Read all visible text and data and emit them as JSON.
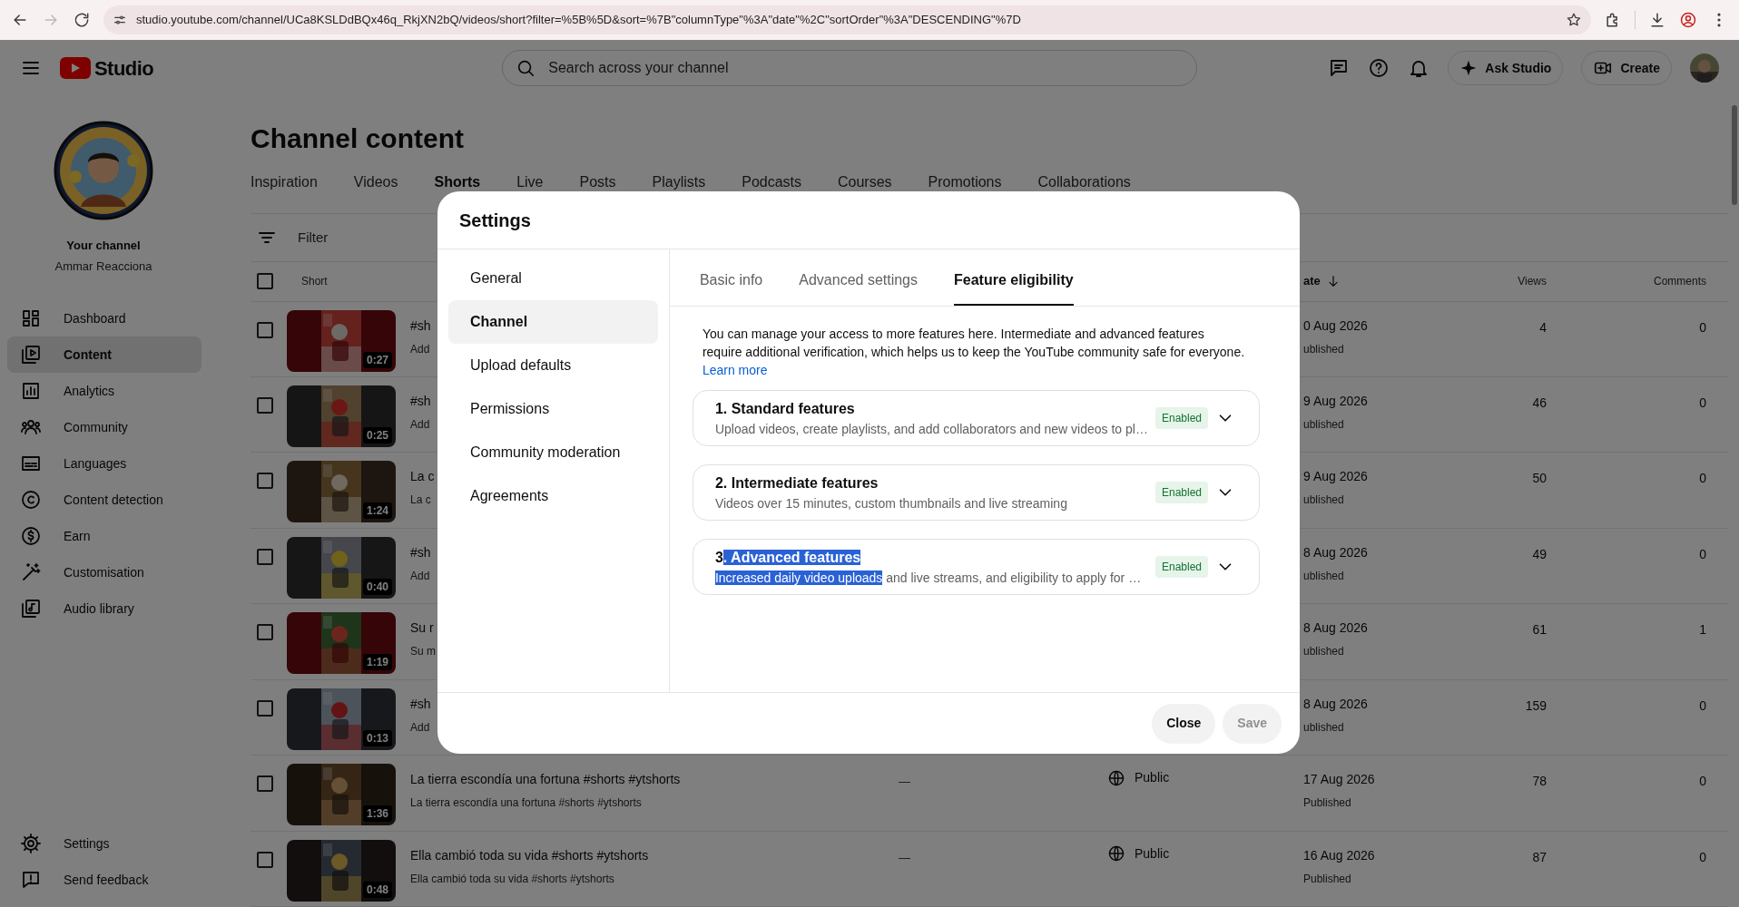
{
  "browser": {
    "url": "studio.youtube.com/channel/UCa8KSLDdBQx46q_RkjXN2bQ/videos/short?filter=%5B%5D&sort=%7B\"columnType\"%3A\"date\"%2C\"sortOrder\"%3A\"DESCENDING\"%7D",
    "back_enabled": true,
    "forward_enabled": false
  },
  "header": {
    "logo_text": "Studio",
    "search_placeholder": "Search across your channel",
    "ask_button": "Ask Studio",
    "create_button": "Create"
  },
  "sidebar": {
    "channel_label": "Your channel",
    "channel_name": "Ammar Reacciona",
    "items": [
      {
        "label": "Dashboard",
        "selected": false
      },
      {
        "label": "Content",
        "selected": true
      },
      {
        "label": "Analytics",
        "selected": false
      },
      {
        "label": "Community",
        "selected": false
      },
      {
        "label": "Languages",
        "selected": false
      },
      {
        "label": "Content detection",
        "selected": false
      },
      {
        "label": "Earn",
        "selected": false
      },
      {
        "label": "Customisation",
        "selected": false
      },
      {
        "label": "Audio library",
        "selected": false
      }
    ],
    "footer_items": [
      {
        "label": "Settings"
      },
      {
        "label": "Send feedback"
      }
    ]
  },
  "main": {
    "title": "Channel content",
    "tabs": [
      {
        "label": "Inspiration",
        "selected": false
      },
      {
        "label": "Videos",
        "selected": false
      },
      {
        "label": "Shorts",
        "selected": true
      },
      {
        "label": "Live",
        "selected": false
      },
      {
        "label": "Posts",
        "selected": false
      },
      {
        "label": "Playlists",
        "selected": false
      },
      {
        "label": "Podcasts",
        "selected": false
      },
      {
        "label": "Courses",
        "selected": false
      },
      {
        "label": "Promotions",
        "selected": false
      },
      {
        "label": "Collaborations",
        "selected": false
      }
    ],
    "filter_placeholder": "Filter",
    "table": {
      "header_checked": false,
      "columns": [
        "Short",
        "ate",
        "Views",
        "Comments"
      ],
      "rows": [
        {
          "checked": false,
          "title": "#sh",
          "description": "Add",
          "duration": "0:27",
          "date": "0 Aug 2026",
          "status": "ublished",
          "views": "4",
          "comments": "0"
        },
        {
          "checked": false,
          "title": "#sh",
          "description": "Add",
          "duration": "0:25",
          "date": "9 Aug 2026",
          "status": "ublished",
          "views": "46",
          "comments": "0"
        },
        {
          "checked": false,
          "title": "La c",
          "description": "La c",
          "duration": "1:24",
          "date": "9 Aug 2026",
          "status": "ublished",
          "views": "50",
          "comments": "0"
        },
        {
          "checked": false,
          "title": "#sh",
          "description": "Add",
          "duration": "0:40",
          "date": "8 Aug 2026",
          "status": "ublished",
          "views": "49",
          "comments": "0"
        },
        {
          "checked": false,
          "title": "Su r",
          "description": "Su m",
          "duration": "1:19",
          "date": "8 Aug 2026",
          "status": "ublished",
          "views": "61",
          "comments": "1"
        },
        {
          "checked": false,
          "title": "#sh",
          "description": "Add",
          "duration": "0:13",
          "date": "8 Aug 2026",
          "status": "ublished",
          "views": "159",
          "comments": "0"
        },
        {
          "checked": false,
          "title": "La tierra escondía una fortuna #shorts #ytshorts",
          "description": "La tierra escondía una fortuna #shorts #ytshorts",
          "duration": "1:36",
          "restrictions": "—",
          "visibility": "Public",
          "date": "17 Aug 2026",
          "status": "Published",
          "views": "78",
          "comments": "0"
        },
        {
          "checked": false,
          "title": "Ella cambió toda su vida #shorts #ytshorts",
          "description": "Ella cambió toda su vida #shorts #ytshorts",
          "duration": "0:48",
          "restrictions": "—",
          "visibility": "Public",
          "date": "16 Aug 2026",
          "status": "Published",
          "views": "87",
          "comments": "0"
        }
      ]
    }
  },
  "modal": {
    "title": "Settings",
    "nav": [
      {
        "label": "General",
        "selected": false
      },
      {
        "label": "Channel",
        "selected": true
      },
      {
        "label": "Upload defaults",
        "selected": false
      },
      {
        "label": "Permissions",
        "selected": false
      },
      {
        "label": "Community moderation",
        "selected": false
      },
      {
        "label": "Agreements",
        "selected": false
      }
    ],
    "tabs": [
      {
        "label": "Basic info",
        "selected": false
      },
      {
        "label": "Advanced settings",
        "selected": false
      },
      {
        "label": "Feature eligibility",
        "selected": true
      }
    ],
    "intro": "You can manage your access to more features here. Intermediate and advanced features require additional verification, which helps us to keep the YouTube community safe for everyone.",
    "link": "Learn more",
    "cards": [
      {
        "title": [
          {
            "text": "1. Standard features",
            "highlighted": false
          }
        ],
        "description": [
          {
            "text": "Upload videos, create playlists, and add collaborators and new videos to pl…",
            "highlighted": false
          }
        ],
        "badge": "Enabled",
        "expanded": false
      },
      {
        "title": [
          {
            "text": "2. Intermediate features",
            "highlighted": false
          }
        ],
        "description": [
          {
            "text": "Videos over 15 minutes, custom thumbnails and live streaming",
            "highlighted": false
          }
        ],
        "badge": "Enabled",
        "expanded": false
      },
      {
        "title": [
          {
            "text": "3",
            "highlighted": false
          },
          {
            "text": ". Advanced features ",
            "highlighted": true
          }
        ],
        "description": [
          {
            "text": "Increased daily video uploads",
            "highlighted": true
          },
          {
            "text": " and live streams, and eligibility to apply for …",
            "highlighted": false
          }
        ],
        "badge": "Enabled",
        "expanded": false
      }
    ],
    "buttons": [
      {
        "label": "Close",
        "disabled": false
      },
      {
        "label": "Save",
        "disabled": true
      }
    ]
  }
}
